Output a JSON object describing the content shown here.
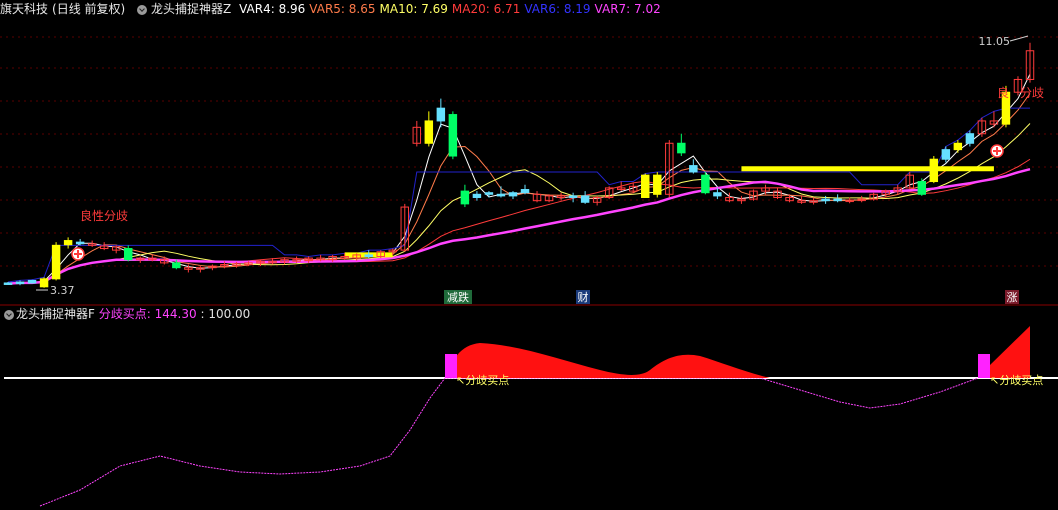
{
  "header": {
    "stock_name": "旗天科技",
    "period": "(日线 前复权)",
    "indicator_name": "龙头捕捉神器Z",
    "items": [
      {
        "label": "VAR4:",
        "value": "8.96",
        "color": "#ffffff"
      },
      {
        "label": "VAR5:",
        "value": "8.65",
        "color": "#ff7b4a"
      },
      {
        "label": "MA10:",
        "value": "7.69",
        "color": "#ffff66"
      },
      {
        "label": "MA20:",
        "value": "6.71",
        "color": "#ff3b3b"
      },
      {
        "label": "VAR6:",
        "value": "8.19",
        "color": "#3333ff"
      },
      {
        "label": "VAR7:",
        "value": "7.02",
        "color": "#ff44ff"
      }
    ]
  },
  "main_chart": {
    "price_high_label": "11.05",
    "price_low_label": "3.37",
    "signal_label_1": "良性分歧",
    "signal_label_2_a": "良",
    "signal_label_2_b": "分歧",
    "markers": [
      {
        "text": "减跌",
        "color": "#ffffff",
        "bg": "#1f6a3a"
      },
      {
        "text": "财",
        "color": "#ffffff",
        "bg": "#1a3a7a"
      },
      {
        "text": "涨",
        "color": "#ffffff",
        "bg": "#7a1a2a"
      }
    ]
  },
  "sub_chart": {
    "indicator_name": "龙头捕捉神器F",
    "label": "分歧买点:",
    "value": "144.30",
    "level": "100.00",
    "callout_1": "分歧买点",
    "callout_2": "分歧买点"
  },
  "chart_data": {
    "type": "candlestick",
    "colors": {
      "up": "#ffff00",
      "down": "#00ff66",
      "doji": "#ff4444",
      "small_up": "#66e0ff",
      "flat_up": "#ff4444"
    },
    "candles": [
      [
        3.52,
        3.55,
        3.48,
        3.5,
        "c"
      ],
      [
        3.5,
        3.6,
        3.45,
        3.55,
        "c"
      ],
      [
        3.6,
        3.62,
        3.5,
        3.52,
        "c"
      ],
      [
        3.4,
        3.7,
        3.37,
        3.65,
        "y"
      ],
      [
        3.65,
        4.8,
        3.6,
        4.7,
        "y"
      ],
      [
        4.72,
        4.95,
        4.6,
        4.85,
        "y"
      ],
      [
        4.8,
        4.9,
        4.7,
        4.75,
        "c"
      ],
      [
        4.75,
        4.85,
        4.65,
        4.7,
        "r"
      ],
      [
        4.68,
        4.8,
        4.55,
        4.6,
        "r"
      ],
      [
        4.55,
        4.7,
        4.45,
        4.65,
        "r"
      ],
      [
        4.6,
        4.7,
        4.2,
        4.25,
        "g"
      ],
      [
        4.25,
        4.35,
        4.15,
        4.3,
        "r"
      ],
      [
        4.3,
        4.4,
        4.2,
        4.25,
        "r"
      ],
      [
        4.25,
        4.35,
        4.1,
        4.15,
        "r"
      ],
      [
        4.15,
        4.25,
        3.95,
        4.0,
        "g"
      ],
      [
        4.0,
        4.1,
        3.85,
        3.95,
        "r"
      ],
      [
        3.95,
        4.05,
        3.85,
        4.0,
        "r"
      ],
      [
        4.0,
        4.1,
        3.92,
        4.05,
        "r"
      ],
      [
        4.05,
        4.2,
        3.98,
        4.1,
        "r"
      ],
      [
        4.1,
        4.18,
        4.0,
        4.12,
        "r"
      ],
      [
        4.12,
        4.2,
        4.05,
        4.15,
        "r"
      ],
      [
        4.15,
        4.25,
        4.05,
        4.2,
        "r"
      ],
      [
        4.2,
        4.3,
        4.1,
        4.18,
        "r"
      ],
      [
        4.18,
        4.3,
        4.1,
        4.25,
        "r"
      ],
      [
        4.25,
        4.35,
        4.15,
        4.22,
        "r"
      ],
      [
        4.22,
        4.35,
        4.15,
        4.3,
        "r"
      ],
      [
        4.3,
        4.4,
        4.2,
        4.25,
        "r"
      ],
      [
        4.25,
        4.4,
        4.18,
        4.35,
        "r"
      ],
      [
        4.35,
        4.45,
        4.25,
        4.3,
        "r"
      ],
      [
        4.3,
        4.45,
        4.22,
        4.4,
        "r"
      ],
      [
        4.4,
        4.55,
        4.3,
        4.35,
        "c"
      ],
      [
        4.35,
        4.55,
        4.3,
        4.5,
        "r"
      ],
      [
        4.5,
        4.6,
        4.4,
        4.55,
        "r"
      ],
      [
        4.55,
        6.0,
        4.5,
        5.9,
        "r"
      ],
      [
        8.4,
        8.6,
        7.8,
        7.9,
        "r"
      ],
      [
        7.9,
        8.9,
        7.8,
        8.6,
        "y"
      ],
      [
        8.6,
        9.3,
        8.4,
        9.0,
        "c"
      ],
      [
        8.8,
        8.9,
        7.4,
        7.5,
        "g"
      ],
      [
        6.4,
        6.6,
        5.9,
        6.0,
        "g"
      ],
      [
        6.2,
        6.4,
        6.1,
        6.3,
        "c"
      ],
      [
        6.3,
        6.4,
        6.2,
        6.35,
        "c"
      ],
      [
        6.3,
        6.55,
        6.2,
        6.25,
        "c"
      ],
      [
        6.25,
        6.4,
        6.15,
        6.35,
        "c"
      ],
      [
        6.35,
        6.6,
        6.3,
        6.45,
        "c"
      ],
      [
        6.3,
        6.4,
        6.05,
        6.1,
        "r"
      ],
      [
        6.1,
        6.3,
        6.05,
        6.25,
        "r"
      ],
      [
        6.25,
        6.35,
        6.1,
        6.2,
        "r"
      ],
      [
        6.2,
        6.35,
        6.05,
        6.25,
        "c"
      ],
      [
        6.25,
        6.4,
        6.0,
        6.05,
        "c"
      ],
      [
        6.05,
        6.25,
        5.95,
        6.2,
        "r"
      ],
      [
        6.2,
        6.55,
        6.15,
        6.5,
        "r"
      ],
      [
        6.5,
        6.7,
        6.4,
        6.45,
        "r"
      ],
      [
        6.4,
        6.65,
        6.35,
        6.55,
        "r"
      ],
      [
        6.2,
        6.95,
        6.2,
        6.9,
        "y"
      ],
      [
        6.9,
        7.0,
        6.2,
        6.3,
        "y"
      ],
      [
        6.3,
        8.0,
        6.2,
        7.9,
        "r"
      ],
      [
        7.9,
        8.2,
        7.5,
        7.6,
        "g"
      ],
      [
        7.2,
        7.4,
        6.95,
        7.0,
        "c"
      ],
      [
        6.9,
        7.0,
        6.3,
        6.35,
        "g"
      ],
      [
        6.35,
        6.5,
        6.15,
        6.25,
        "c"
      ],
      [
        6.2,
        6.35,
        6.05,
        6.1,
        "r"
      ],
      [
        6.1,
        6.25,
        6.0,
        6.15,
        "r"
      ],
      [
        6.15,
        6.45,
        6.1,
        6.4,
        "r"
      ],
      [
        6.4,
        6.6,
        6.3,
        6.5,
        "r"
      ],
      [
        6.4,
        6.5,
        6.15,
        6.2,
        "r"
      ],
      [
        6.2,
        6.3,
        6.05,
        6.1,
        "r"
      ],
      [
        6.1,
        6.25,
        6.0,
        6.05,
        "r"
      ],
      [
        6.05,
        6.2,
        5.98,
        6.1,
        "r"
      ],
      [
        6.1,
        6.25,
        6.0,
        6.15,
        "c"
      ],
      [
        6.15,
        6.3,
        6.05,
        6.1,
        "c"
      ],
      [
        6.1,
        6.2,
        6.02,
        6.12,
        "r"
      ],
      [
        6.12,
        6.25,
        6.05,
        6.15,
        "r"
      ],
      [
        6.15,
        6.35,
        6.1,
        6.3,
        "r"
      ],
      [
        6.3,
        6.45,
        6.2,
        6.4,
        "r"
      ],
      [
        6.4,
        6.6,
        6.3,
        6.5,
        "r"
      ],
      [
        6.5,
        7.0,
        6.45,
        6.9,
        "r"
      ],
      [
        6.3,
        6.8,
        6.25,
        6.7,
        "g"
      ],
      [
        6.7,
        7.5,
        6.65,
        7.4,
        "y"
      ],
      [
        7.4,
        7.8,
        7.3,
        7.7,
        "c"
      ],
      [
        7.7,
        8.0,
        7.6,
        7.9,
        "y"
      ],
      [
        7.9,
        8.3,
        7.8,
        8.2,
        "c"
      ],
      [
        8.2,
        8.7,
        8.1,
        8.6,
        "r"
      ],
      [
        8.6,
        8.9,
        8.4,
        8.5,
        "r"
      ],
      [
        8.5,
        9.7,
        8.4,
        9.5,
        "y"
      ],
      [
        9.5,
        10.0,
        9.4,
        9.9,
        "r"
      ],
      [
        9.9,
        11.05,
        9.8,
        10.8,
        "r"
      ]
    ]
  }
}
